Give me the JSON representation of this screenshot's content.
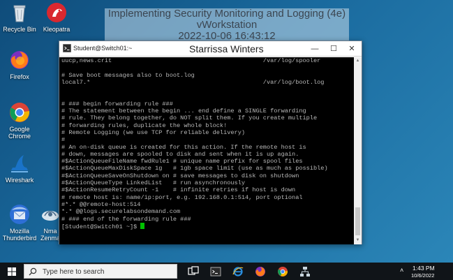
{
  "banner": {
    "line1": "Implementing Security Monitoring and Logging (4e)",
    "line2": "vWorkstation",
    "line3": "2022-10-06 16:43:12"
  },
  "desktop_icons": [
    {
      "label1": "Recycle Bin",
      "label2": "",
      "icon": "recycle-bin-icon"
    },
    {
      "label1": "Kleopatra",
      "label2": "",
      "icon": "kleopatra-icon"
    },
    {
      "label1": "Firefox",
      "label2": "",
      "icon": "firefox-icon"
    },
    {
      "label1": "Google",
      "label2": "Chrome",
      "icon": "chrome-icon"
    },
    {
      "label1": "Wireshark",
      "label2": "",
      "icon": "wireshark-icon"
    },
    {
      "label1": "Mozilla",
      "label2": "Thunderbird",
      "icon": "thunderbird-icon"
    },
    {
      "label1": "Nma",
      "label2": "Zenma",
      "icon": "zenmap-icon"
    }
  ],
  "window": {
    "title": "Student@Switch01:~",
    "overlay_name": "Starrissa Winters",
    "minimize": "—",
    "maximize": "☐",
    "close": "✕"
  },
  "terminal": {
    "lines": [
      "uucp,news.crit                                          /var/log/spooler",
      "",
      "# Save boot messages also to boot.log",
      "local7.*                                                /var/log/boot.log",
      "",
      "",
      "# ### begin forwarding rule ###",
      "# The statement between the begin ... end define a SINGLE forwarding",
      "# rule. They belong together, do NOT split them. If you create multiple",
      "# forwarding rules, duplicate the whole block!",
      "# Remote Logging (we use TCP for reliable delivery)",
      "#",
      "# An on-disk queue is created for this action. If the remote host is",
      "# down, messages are spooled to disk and sent when it is up again.",
      "#$ActionQueueFileName fwdRule1 # unique name prefix for spool files",
      "#$ActionQueueMaxDiskSpace 1g   # 1gb space limit (use as much as possible)",
      "#$ActionQueueSaveOnShutdown on # save messages to disk on shutdown",
      "#$ActionQueueType LinkedList   # run asynchronously",
      "#$ActionResumeRetryCount -1    # infinite retries if host is down",
      "# remote host is: name/ip:port, e.g. 192.168.0.1:514, port optional",
      "#*.* @@remote-host:514",
      "*.* @@logs.securelabsondemand.com",
      "# ### end of the forwarding rule ###"
    ],
    "prompt": "[Student@Switch01 ~]$ "
  },
  "taskbar": {
    "search_placeholder": "Type here to search",
    "apps": [
      "task-view-icon",
      "terminal-icon",
      "ie-icon",
      "firefox-icon",
      "chrome-icon",
      "network-icon"
    ],
    "time": "1:43 PM",
    "date": "10/6/2022"
  }
}
